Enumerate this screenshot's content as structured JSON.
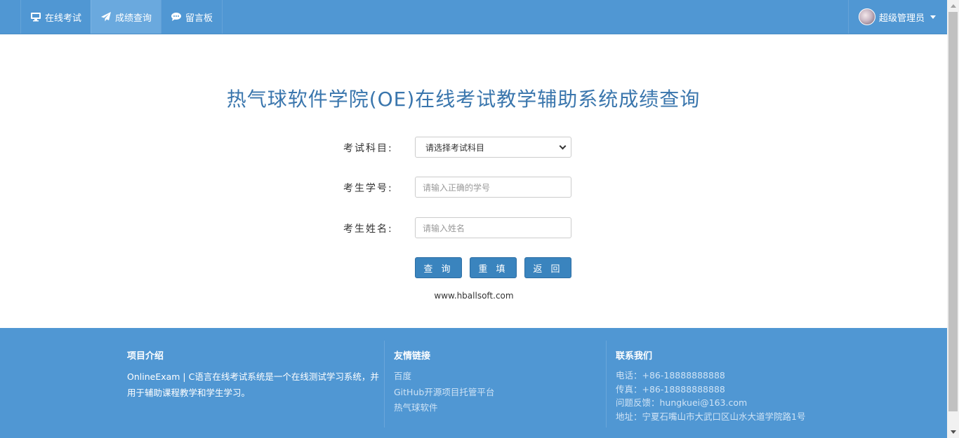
{
  "nav": {
    "items": [
      {
        "label": "在线考试",
        "icon": "monitor-icon"
      },
      {
        "label": "成绩查询",
        "icon": "paper-plane-icon"
      },
      {
        "label": "留言板",
        "icon": "comment-icon"
      }
    ],
    "user": {
      "name": "超级管理员",
      "icon": "chevron-down-icon"
    }
  },
  "main": {
    "title": "热气球软件学院(OE)在线考试教学辅助系统成绩查询",
    "subject_label": "考试科目:",
    "subject_selected": "请选择考试科目",
    "student_id_label": "考生学号:",
    "student_id_placeholder": "请输入正确的学号",
    "student_name_label": "考生姓名:",
    "student_name_placeholder": "请输入姓名",
    "buttons": {
      "query": "查 询",
      "reset": "重 填",
      "back": "返 回"
    },
    "site_url": "www.hballsoft.com"
  },
  "footer": {
    "intro_title": "项目介绍",
    "intro_text": "OnlineExam | C语言在线考试系统是一个在线测试学习系统，并用于辅助课程教学和学生学习。",
    "links_title": "友情链接",
    "links": [
      "百度",
      "GitHub开源项目托管平台",
      "热气球软件"
    ],
    "contact_title": "联系我们",
    "contact": [
      "电话：+86-18888888888",
      "传真：+86-18888888888",
      "问题反馈：hungkuei@163.com",
      "地址：宁夏石嘴山市大武口区山水大道学院路1号"
    ]
  },
  "colors": {
    "primary": "#5097d3",
    "title": "#3a76ad",
    "button": "#3a84be"
  }
}
